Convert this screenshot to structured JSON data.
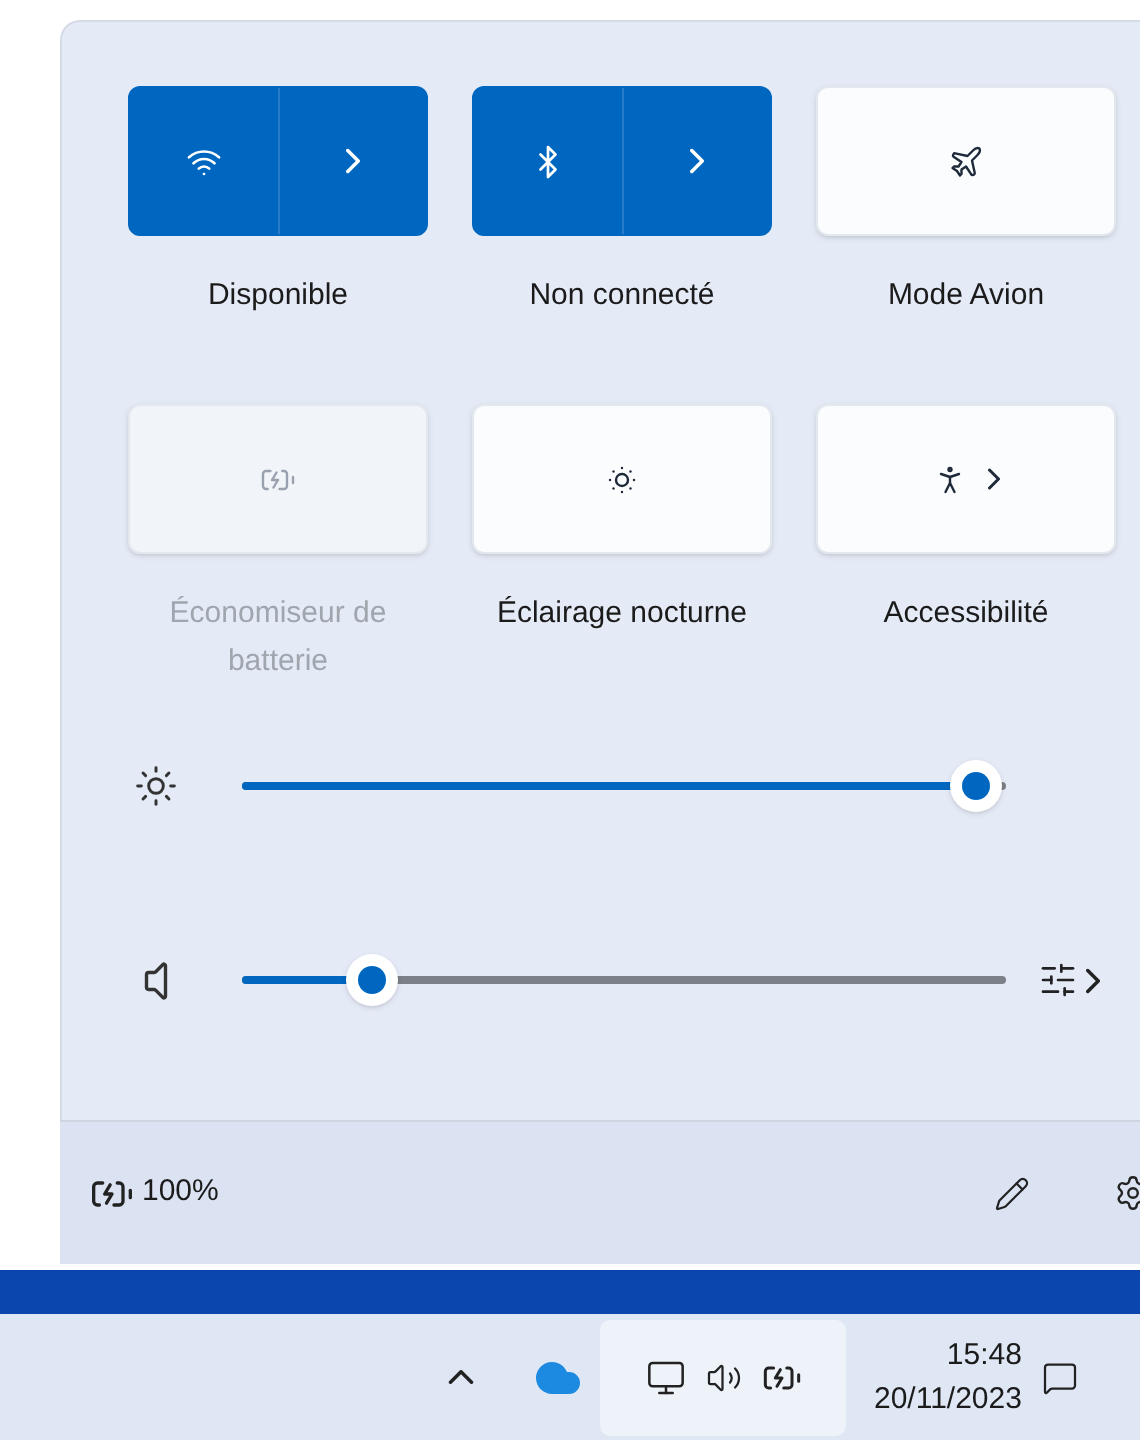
{
  "tiles": [
    {
      "kind": "split",
      "label": "Disponible",
      "on": true,
      "disabled": false
    },
    {
      "kind": "split",
      "label": "Non connecté",
      "on": true,
      "disabled": false
    },
    {
      "kind": "button",
      "label": "Mode Avion",
      "on": false,
      "disabled": false
    },
    {
      "kind": "button",
      "label": "Économiseur de batterie",
      "on": false,
      "disabled": true
    },
    {
      "kind": "button",
      "label": "Éclairage nocturne",
      "on": false,
      "disabled": false
    },
    {
      "kind": "menu",
      "label": "Accessibilité",
      "on": false,
      "disabled": false
    }
  ],
  "sliders": [
    {
      "kind": "brightness",
      "level": 0.96
    },
    {
      "kind": "volume",
      "level": 0.17
    }
  ],
  "footer": {
    "battery": "100%"
  },
  "taskbar": {
    "time": "15:48",
    "date": "20/11/2023"
  }
}
